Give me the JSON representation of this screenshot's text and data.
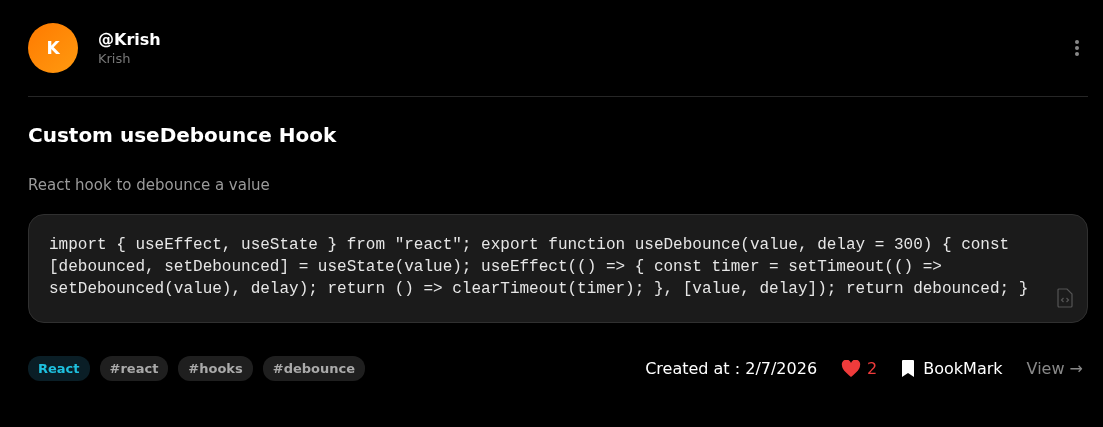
{
  "author": {
    "initial": "K",
    "handle": "@Krish",
    "name": "Krish"
  },
  "post": {
    "title": "Custom useDebounce Hook",
    "description": "React hook to debounce a value",
    "code": "import { useEffect, useState } from \"react\"; export function useDebounce(value, delay = 300) { const [debounced, setDebounced] = useState(value); useEffect(() => { const timer = setTimeout(() => setDebounced(value), delay); return () => clearTimeout(timer); }, [value, delay]); return debounced; }"
  },
  "tags": [
    {
      "label": "React",
      "kind": "category"
    },
    {
      "label": "#react",
      "kind": "hashtag"
    },
    {
      "label": "#hooks",
      "kind": "hashtag"
    },
    {
      "label": "#debounce",
      "kind": "hashtag"
    }
  ],
  "footer": {
    "created": "Created at : 2/7/2026",
    "liked": true,
    "likes": "2",
    "bookmark": "BookMark",
    "view": "View →"
  }
}
